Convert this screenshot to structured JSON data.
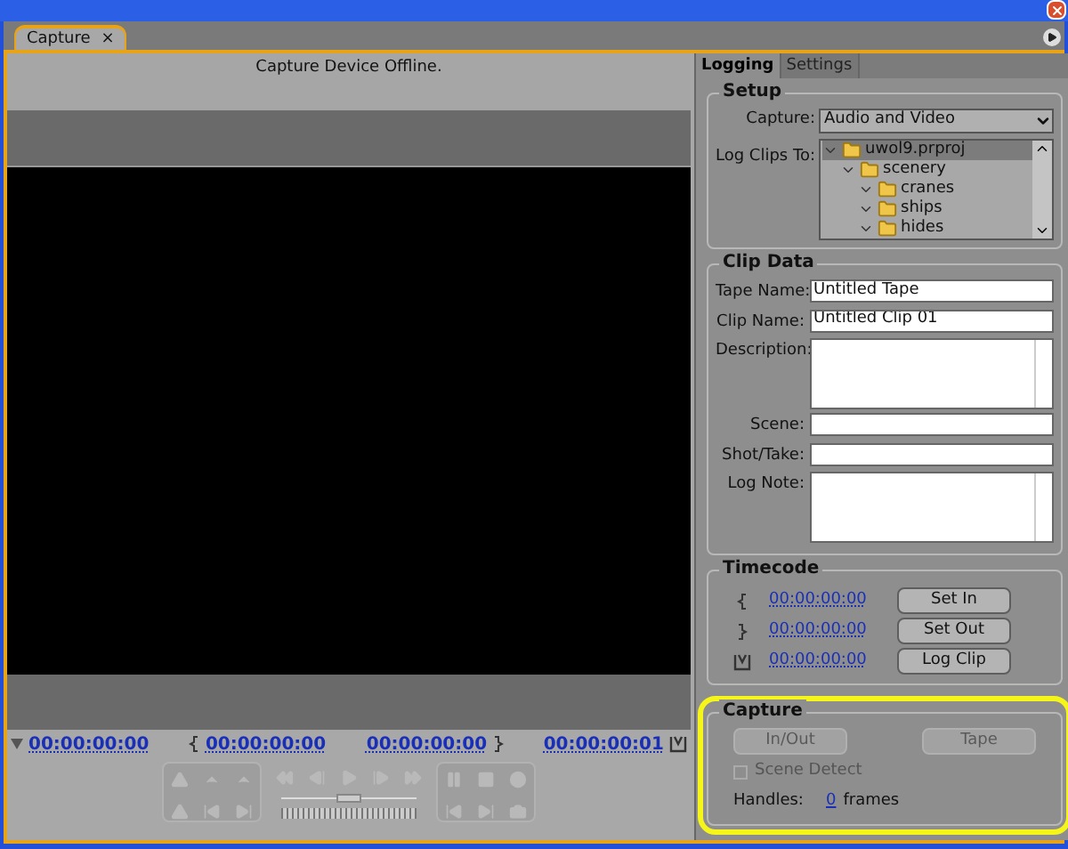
{
  "panel_tab": {
    "label": "Capture",
    "close": "×"
  },
  "monitor": {
    "status": "Capture Device Offline.",
    "shuttle": {
      "level": 0.5
    },
    "timecodes": [
      {
        "kind": "current",
        "value": "00:00:00:00"
      },
      {
        "kind": "in",
        "value": "00:00:00:00"
      },
      {
        "kind": "out",
        "value": "00:00:00:00"
      },
      {
        "kind": "duration",
        "value": "00:00:00:01"
      }
    ]
  },
  "tabs": [
    {
      "label": "Logging",
      "selected": true
    },
    {
      "label": "Settings",
      "selected": false
    }
  ],
  "setup": {
    "title": "Setup",
    "capture_label": "Capture:",
    "capture_value": "Audio and Video",
    "log_label": "Log Clips To:",
    "tree": [
      {
        "label": "uwol9.prproj",
        "selected": true,
        "children": [
          {
            "label": "scenery",
            "selected": false,
            "children": [
              {
                "label": "cranes",
                "selected": false
              },
              {
                "label": "ships",
                "selected": false
              },
              {
                "label": "hides",
                "selected": false
              }
            ]
          }
        ]
      }
    ]
  },
  "clip_data": {
    "title": "Clip Data",
    "fields": [
      {
        "kind": "line",
        "label": "Tape Name:",
        "value": "Untitled Tape"
      },
      {
        "kind": "line",
        "label": "Clip Name:",
        "value": "Untitled Clip 01"
      },
      {
        "kind": "multiline",
        "label": "Description:"
      },
      {
        "kind": "line",
        "label": "Scene:"
      },
      {
        "kind": "line",
        "label": "Shot/Take:"
      },
      {
        "kind": "multiline",
        "label": "Log Note:"
      }
    ]
  },
  "timecode": {
    "title": "Timecode",
    "rows": [
      {
        "kind": "in",
        "value": "00:00:00:00",
        "button": "Set In"
      },
      {
        "kind": "out",
        "value": "00:00:00:00",
        "button": "Set Out"
      },
      {
        "kind": "duration",
        "value": "00:00:00:00",
        "button": "Log Clip"
      }
    ]
  },
  "capture": {
    "title": "Capture",
    "highlighted": true,
    "buttons": [
      {
        "label": "In/Out",
        "disabled": true
      },
      {
        "label": "Tape",
        "disabled": true
      }
    ],
    "scene_detect": {
      "label": "Scene Detect",
      "checked": false,
      "disabled": true
    },
    "handles_label": "Handles:",
    "handles_value": "0",
    "handles_unit": "frames"
  }
}
